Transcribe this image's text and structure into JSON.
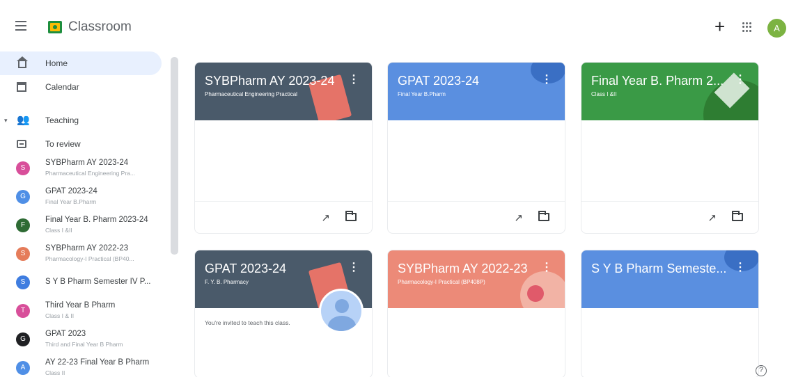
{
  "header": {
    "app_title": "Classroom",
    "account_initial": "A",
    "plus_glyph": "+",
    "menu_icon": "menu-icon",
    "apps_icon": "apps-grid-icon"
  },
  "sidebar": {
    "home_label": "Home",
    "calendar_label": "Calendar",
    "teaching_label": "Teaching",
    "to_review_label": "To review",
    "classes": [
      {
        "initial": "S",
        "color": "#d84f9a",
        "name": "SYBPharm AY 2023-24",
        "sub": "Pharmaceutical Engineering Pra..."
      },
      {
        "initial": "G",
        "color": "#4f8fe6",
        "name": "GPAT 2023-24",
        "sub": "Final Year B.Pharm"
      },
      {
        "initial": "F",
        "color": "#2e6b34",
        "name": "Final Year B. Pharm 2023-24",
        "sub": "Class I &II"
      },
      {
        "initial": "S",
        "color": "#e57c5a",
        "name": "SYBPharm AY 2022-23",
        "sub": "Pharmacology-I Practical (BP40..."
      },
      {
        "initial": "S",
        "color": "#3f7de0",
        "name": "S Y B Pharm Semester IV P...",
        "sub": ""
      },
      {
        "initial": "T",
        "color": "#d84f9a",
        "name": "Third Year B Pharm",
        "sub": "Class I & II"
      },
      {
        "initial": "G",
        "color": "#202124",
        "name": "GPAT 2023",
        "sub": "Third and Final Year B Pharm"
      },
      {
        "initial": "A",
        "color": "#4f8fe6",
        "name": "AY 22-23 Final Year B Pharm",
        "sub": "Class II"
      }
    ]
  },
  "cards": [
    {
      "title": "SYBPharm AY 2023-24",
      "sub": "Pharmaceutical Engineering Practical",
      "color": "#4a5a6a",
      "footer": true,
      "invite": ""
    },
    {
      "title": "GPAT 2023-24",
      "sub": "Final Year B.Pharm",
      "color": "#5a8fe0",
      "footer": true,
      "invite": ""
    },
    {
      "title": "Final Year B. Pharm 2...",
      "sub": "Class I &II",
      "color": "#3a9a46",
      "footer": true,
      "invite": ""
    },
    {
      "title": "GPAT 2023-24",
      "sub": "F. Y. B. Pharmacy",
      "color": "#4a5a6a",
      "footer": false,
      "invite": "You're invited to teach this class."
    },
    {
      "title": "SYBPharm AY 2022-23",
      "sub": "Pharmacology-I Practical (BP408P)",
      "color": "#ec8a78",
      "footer": false,
      "invite": ""
    },
    {
      "title": "S Y B Pharm Semeste...",
      "sub": "",
      "color": "#5a8fe0",
      "footer": false,
      "invite": ""
    }
  ],
  "icons": {
    "more": "more-vert-icon",
    "trend": "trending-icon",
    "folder": "folder-icon",
    "help": "help-icon"
  },
  "help_glyph": "?"
}
